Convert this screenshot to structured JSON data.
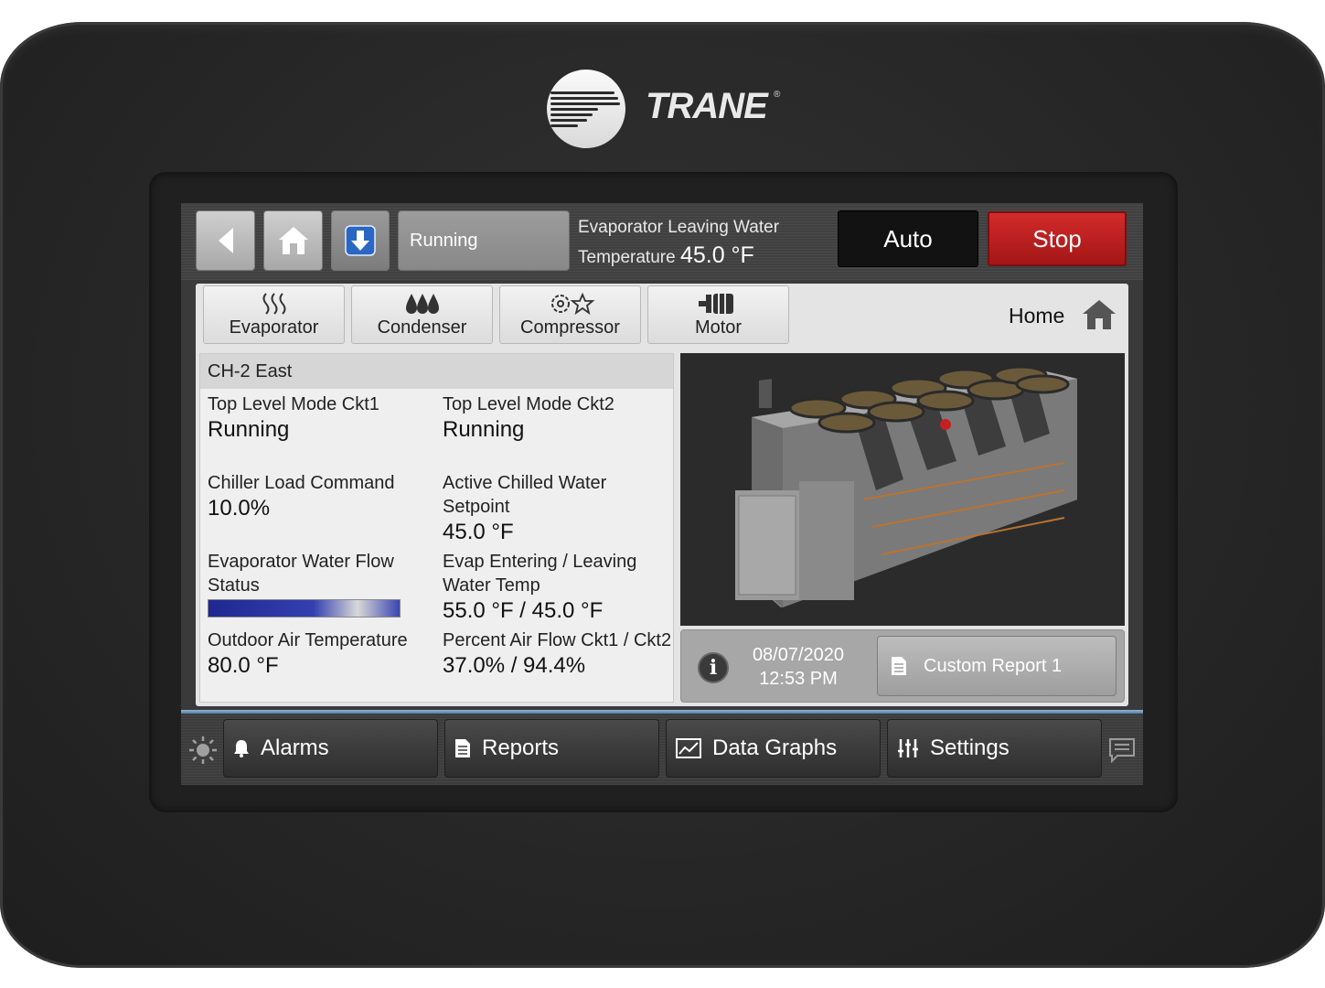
{
  "brand": {
    "name": "TRANE",
    "reg": "®"
  },
  "toolbar": {
    "status": "Running",
    "evap_label_line1": "Evaporator Leaving Water",
    "evap_label_line2": "Temperature",
    "evap_value": "45.0 °F",
    "auto_label": "Auto",
    "stop_label": "Stop"
  },
  "tabs": [
    {
      "label": "Evaporator",
      "icon": "evaporator-icon"
    },
    {
      "label": "Condenser",
      "icon": "condenser-icon"
    },
    {
      "label": "Compressor",
      "icon": "compressor-icon"
    },
    {
      "label": "Motor",
      "icon": "motor-icon"
    }
  ],
  "home_label": "Home",
  "panel": {
    "title": "CH-2 East",
    "fields": {
      "mode1_label": "Top Level Mode Ckt1",
      "mode1_value": "Running",
      "mode2_label": "Top Level Mode Ckt2",
      "mode2_value": "Running",
      "load_label": "Chiller Load Command",
      "load_value": "10.0%",
      "setpoint_label_1": "Active Chilled Water",
      "setpoint_label_2": "Setpoint",
      "setpoint_value": "45.0 °F",
      "flow_label_1": "Evaporator Water Flow",
      "flow_label_2": "Status",
      "evap_temp_label_1": "Evap Entering / Leaving",
      "evap_temp_label_2": "Water Temp",
      "evap_temp_value": "55.0 °F / 45.0 °F",
      "oat_label": "Outdoor Air Temperature",
      "oat_value": "80.0 °F",
      "airflow_label": "Percent Air Flow Ckt1 / Ckt2",
      "airflow_value": "37.0% / 94.4%"
    }
  },
  "info": {
    "date": "08/07/2020",
    "time": "12:53 PM",
    "report_label": "Custom Report 1"
  },
  "nav": [
    {
      "label": "Alarms",
      "icon": "bell-icon"
    },
    {
      "label": "Reports",
      "icon": "document-icon"
    },
    {
      "label": "Data Graphs",
      "icon": "graph-icon"
    },
    {
      "label": "Settings",
      "icon": "sliders-icon"
    }
  ],
  "colors": {
    "stop": "#c42020",
    "accent_blue": "#2a66c4"
  }
}
